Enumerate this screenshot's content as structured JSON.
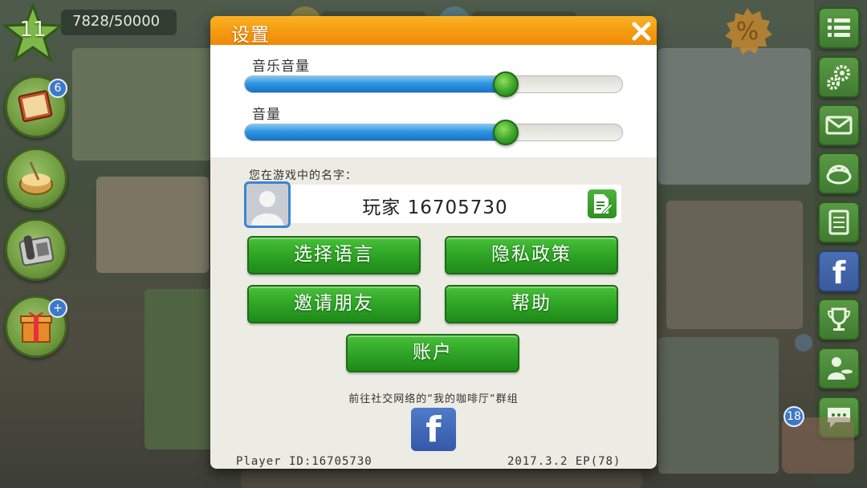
{
  "hud": {
    "level": "11",
    "xp": "7828/50000"
  },
  "left_buttons": [
    {
      "name": "recipe-book",
      "badge": "6"
    },
    {
      "name": "cooking-pot",
      "badge": ""
    },
    {
      "name": "telephone",
      "badge": ""
    },
    {
      "name": "gift",
      "badge": "+"
    }
  ],
  "right_buttons": [
    "menu",
    "settings",
    "mail",
    "cake",
    "orders",
    "facebook",
    "trophy",
    "waiter",
    "chat"
  ],
  "right_badge": "18",
  "settings": {
    "title": "设置",
    "music_volume_label": "音乐音量",
    "music_volume_value": 0.69,
    "volume_label": "音量",
    "volume_value": 0.69,
    "name_label": "您在游戏中的名字：",
    "player_name": "玩家 16705730",
    "buttons": {
      "select_language": "选择语言",
      "privacy_policy": "隐私政策",
      "invite_friends": "邀请朋友",
      "help": "帮助",
      "account": "账户"
    },
    "social_text": "前往社交网络的“我的咖啡厅“群组",
    "facebook_label": "f",
    "player_id": "Player ID:16705730",
    "version": "2017.3.2 EP(78)"
  },
  "colors": {
    "header_orange": "#f59a10",
    "button_green": "#2fa426",
    "slider_blue": "#2f96e2",
    "knob_green": "#3ca22a",
    "facebook_blue": "#3b5998"
  }
}
